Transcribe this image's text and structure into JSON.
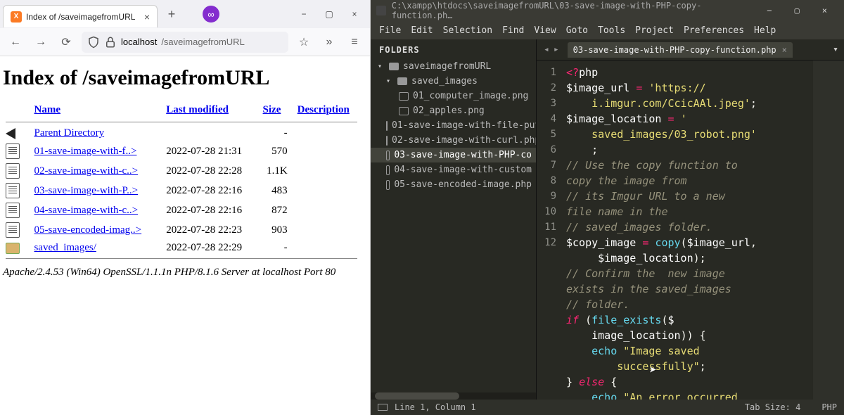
{
  "browser": {
    "tab_title": "Index of /saveimagefromURL",
    "plus": "+",
    "close": "×",
    "pill": "∞",
    "win_min": "−",
    "win_max": "▢",
    "win_close": "×",
    "toolbar": {
      "back": "←",
      "forward": "→",
      "reload": "⟳",
      "shield": "◯",
      "lock": "🔒",
      "star": "☆",
      "overflow": "»",
      "hamburger": "≡"
    },
    "address_host": "localhost",
    "address_path": "/saveimagefromURL",
    "page": {
      "h1": "Index of /saveimagefromURL",
      "headers": {
        "name": "Name",
        "modified": "Last modified",
        "size": "Size",
        "desc": "Description"
      },
      "entries": [
        {
          "type": "back",
          "name": "Parent Directory",
          "modified": "",
          "size": "-"
        },
        {
          "type": "file",
          "name": "01-save-image-with-f..>",
          "modified": "2022-07-28 21:31",
          "size": "570"
        },
        {
          "type": "file",
          "name": "02-save-image-with-c..>",
          "modified": "2022-07-28 22:28",
          "size": "1.1K"
        },
        {
          "type": "file",
          "name": "03-save-image-with-P..>",
          "modified": "2022-07-28 22:16",
          "size": "483"
        },
        {
          "type": "file",
          "name": "04-save-image-with-c..>",
          "modified": "2022-07-28 22:16",
          "size": "872"
        },
        {
          "type": "file",
          "name": "05-save-encoded-imag..>",
          "modified": "2022-07-28 22:23",
          "size": "903"
        },
        {
          "type": "folder",
          "name": "saved_images/",
          "modified": "2022-07-28 22:29",
          "size": "-"
        }
      ],
      "footer": "Apache/2.4.53 (Win64) OpenSSL/1.1.1n PHP/8.1.6 Server at localhost Port 80"
    }
  },
  "sublime": {
    "title_path": "C:\\xampp\\htdocs\\saveimagefromURL\\03-save-image-with-PHP-copy-function.ph…",
    "win_min": "−",
    "win_max": "▢",
    "win_close": "×",
    "menu": [
      "File",
      "Edit",
      "Selection",
      "Find",
      "View",
      "Goto",
      "Tools",
      "Project",
      "Preferences",
      "Help"
    ],
    "sidebar": {
      "head": "FOLDERS",
      "tree": [
        {
          "kind": "folder",
          "depth": 0,
          "arrow": "▾",
          "label": "saveimagefromURL"
        },
        {
          "kind": "folder",
          "depth": 1,
          "arrow": "▾",
          "label": "saved_images"
        },
        {
          "kind": "img",
          "depth": 2,
          "label": "01_computer_image.png"
        },
        {
          "kind": "img",
          "depth": 2,
          "label": "02_apples.png"
        },
        {
          "kind": "file",
          "depth": 1,
          "label": "01-save-image-with-file-put"
        },
        {
          "kind": "file",
          "depth": 1,
          "label": "02-save-image-with-curl.php"
        },
        {
          "kind": "file",
          "depth": 1,
          "sel": true,
          "label": "03-save-image-with-PHP-co"
        },
        {
          "kind": "file",
          "depth": 1,
          "label": "04-save-image-with-custom"
        },
        {
          "kind": "file",
          "depth": 1,
          "label": "05-save-encoded-image.php"
        }
      ]
    },
    "tab": {
      "nav_left": "◂",
      "nav_right": "▸",
      "name": "03-save-image-with-PHP-copy-function.php",
      "close": "×",
      "ctx": "▾"
    },
    "gutter": [
      "1",
      "2",
      "",
      "3",
      "",
      "",
      "4",
      "",
      "5",
      "",
      "6",
      "7",
      "",
      "8",
      "",
      "9",
      "10",
      "",
      "11",
      "",
      "12",
      ""
    ],
    "code_lines": [
      [
        {
          "c": "tok-tag",
          "t": "<?"
        },
        {
          "c": "tok-php",
          "t": "php"
        }
      ],
      [
        {
          "c": "tok-var",
          "t": "$image_url"
        },
        {
          "c": "",
          "t": " "
        },
        {
          "c": "tok-op",
          "t": "="
        },
        {
          "c": "",
          "t": " "
        },
        {
          "c": "tok-str",
          "t": "'https://"
        }
      ],
      [
        {
          "c": "tok-str",
          "t": "    i.imgur.com/CcicAAl.jpeg'"
        },
        {
          "c": "",
          "t": ";"
        }
      ],
      [
        {
          "c": "tok-var",
          "t": "$image_location"
        },
        {
          "c": "",
          "t": " "
        },
        {
          "c": "tok-op",
          "t": "="
        },
        {
          "c": "",
          "t": " "
        },
        {
          "c": "tok-str",
          "t": "'"
        }
      ],
      [
        {
          "c": "tok-str",
          "t": "    saved_images/03_robot.png'"
        }
      ],
      [
        {
          "c": "",
          "t": "    ;"
        }
      ],
      [
        {
          "c": "tok-cmt",
          "t": "// Use the copy function to"
        }
      ],
      [
        {
          "c": "tok-cmt",
          "t": "copy the image from"
        }
      ],
      [
        {
          "c": "tok-cmt",
          "t": "// its Imgur URL to a new"
        }
      ],
      [
        {
          "c": "tok-cmt",
          "t": "file name in the"
        }
      ],
      [
        {
          "c": "tok-cmt",
          "t": "// saved_images folder."
        }
      ],
      [
        {
          "c": "tok-var",
          "t": "$copy_image"
        },
        {
          "c": "",
          "t": " "
        },
        {
          "c": "tok-op",
          "t": "="
        },
        {
          "c": "",
          "t": " "
        },
        {
          "c": "tok-fn",
          "t": "copy"
        },
        {
          "c": "",
          "t": "("
        },
        {
          "c": "tok-var",
          "t": "$image_url"
        },
        {
          "c": "",
          "t": ","
        }
      ],
      [
        {
          "c": "",
          "t": "     "
        },
        {
          "c": "tok-var",
          "t": "$image_location"
        },
        {
          "c": "",
          "t": ");"
        }
      ],
      [
        {
          "c": "tok-cmt",
          "t": "// Confirm the  new image"
        }
      ],
      [
        {
          "c": "tok-cmt",
          "t": "exists in the saved_images"
        }
      ],
      [
        {
          "c": "tok-cmt",
          "t": "// folder."
        }
      ],
      [
        {
          "c": "tok-kw",
          "t": "if"
        },
        {
          "c": "",
          "t": " ("
        },
        {
          "c": "tok-fn",
          "t": "file_exists"
        },
        {
          "c": "",
          "t": "("
        },
        {
          "c": "tok-var",
          "t": "$"
        }
      ],
      [
        {
          "c": "",
          "t": "    "
        },
        {
          "c": "tok-var",
          "t": "image_location"
        },
        {
          "c": "",
          "t": ")) {"
        }
      ],
      [
        {
          "c": "",
          "t": "    "
        },
        {
          "c": "tok-fn",
          "t": "echo"
        },
        {
          "c": "",
          "t": " "
        },
        {
          "c": "tok-str",
          "t": "\"Image saved"
        }
      ],
      [
        {
          "c": "tok-str",
          "t": "        successfully\""
        },
        {
          "c": "",
          "t": ";"
        }
      ],
      [
        {
          "c": "",
          "t": "} "
        },
        {
          "c": "tok-kw",
          "t": "else"
        },
        {
          "c": "",
          "t": " {"
        }
      ],
      [
        {
          "c": "",
          "t": "    "
        },
        {
          "c": "tok-fn",
          "t": "echo"
        },
        {
          "c": "",
          "t": " "
        },
        {
          "c": "tok-str",
          "t": "\"An error occurred"
        }
      ]
    ],
    "status": {
      "pos": "Line 1, Column 1",
      "tabsize": "Tab Size: 4",
      "lang": "PHP"
    }
  }
}
